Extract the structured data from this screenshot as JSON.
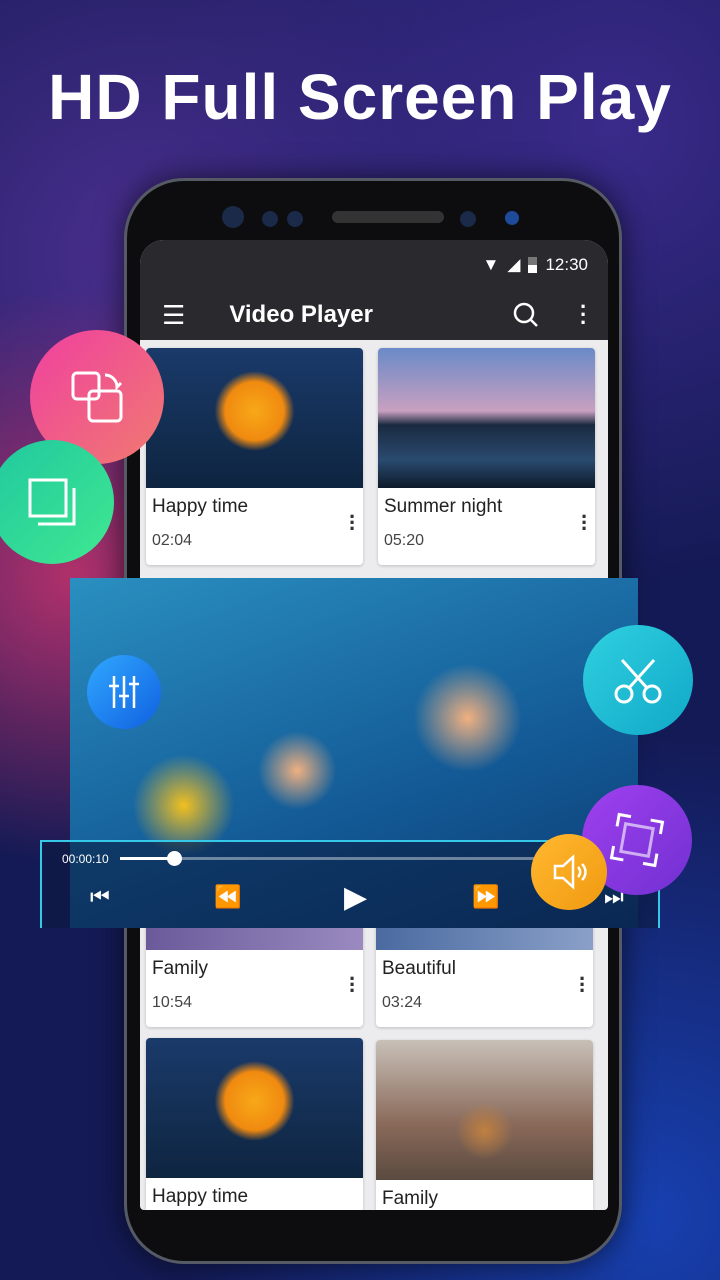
{
  "headline": "HD Full Screen Play",
  "status": {
    "time": "12:30"
  },
  "toolbar": {
    "title": "Video Player"
  },
  "videos": [
    {
      "name": "Happy time",
      "duration": "02:04"
    },
    {
      "name": "Summer night",
      "duration": "05:20"
    },
    {
      "name": "Family",
      "duration": "10:54"
    },
    {
      "name": "Beautiful",
      "duration": "03:24"
    },
    {
      "name": "Happy time"
    },
    {
      "name": "Family"
    }
  ],
  "player": {
    "elapsed": "00:00:10",
    "progress_percent": 12
  },
  "colors": {
    "rotate": "#f0508a",
    "copy": "#2ed8a0",
    "equalizer": "#1a90f0",
    "cut": "#20c0d8",
    "crop": "#9040e0",
    "volume": "#f5a820"
  }
}
